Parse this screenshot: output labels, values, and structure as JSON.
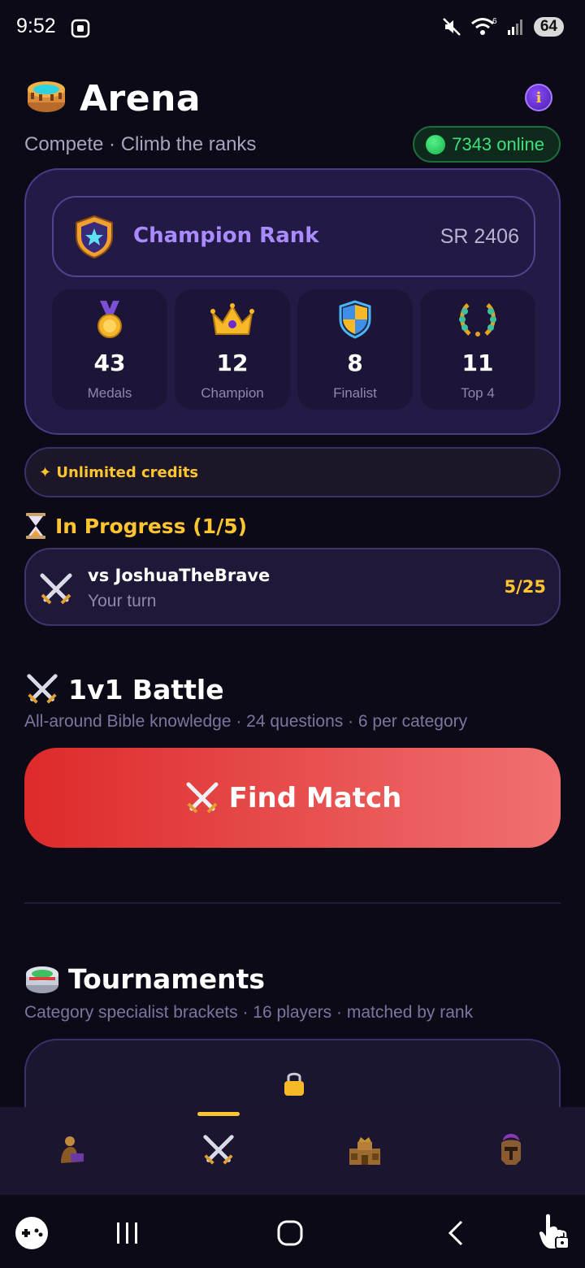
{
  "status_bar": {
    "time": "9:52",
    "network": "6",
    "battery": "64"
  },
  "header": {
    "title": "Arena",
    "subtitle": "Compete · Climb the ranks",
    "online_text": "7343 online",
    "info_glyph": "i"
  },
  "rank": {
    "name": "Champion Rank",
    "sr": "SR 2406"
  },
  "stats": [
    {
      "value": "43",
      "label": "Medals",
      "icon": "medal-icon"
    },
    {
      "value": "12",
      "label": "Champion",
      "icon": "crown-icon"
    },
    {
      "value": "8",
      "label": "Finalist",
      "icon": "shield-icon"
    },
    {
      "value": "11",
      "label": "Top 4",
      "icon": "laurel-wreath-icon"
    }
  ],
  "credits": {
    "text": "✦ Unlimited credits"
  },
  "in_progress": {
    "heading": "In Progress (1/5)",
    "match": {
      "opponent": "vs JoshuaTheBrave",
      "status": "Your turn",
      "progress": "5/25"
    }
  },
  "battle": {
    "heading": "1v1 Battle",
    "subtitle": "All-around Bible knowledge · 24 questions · 6 per category",
    "button_label": "Find Match"
  },
  "tournaments": {
    "heading": "Tournaments",
    "subtitle": "Category specialist brackets · 16 players · matched by rank"
  },
  "bottom_nav": {
    "items": [
      "reader-icon",
      "swords-icon",
      "castle-icon",
      "helmet-icon"
    ],
    "active_index": 1
  },
  "colors": {
    "accent_gold": "#ffc531",
    "accent_purple": "#a98bff",
    "online_green": "#3ee07a",
    "find_match_start": "#de2a2a",
    "find_match_end": "#f07070"
  }
}
